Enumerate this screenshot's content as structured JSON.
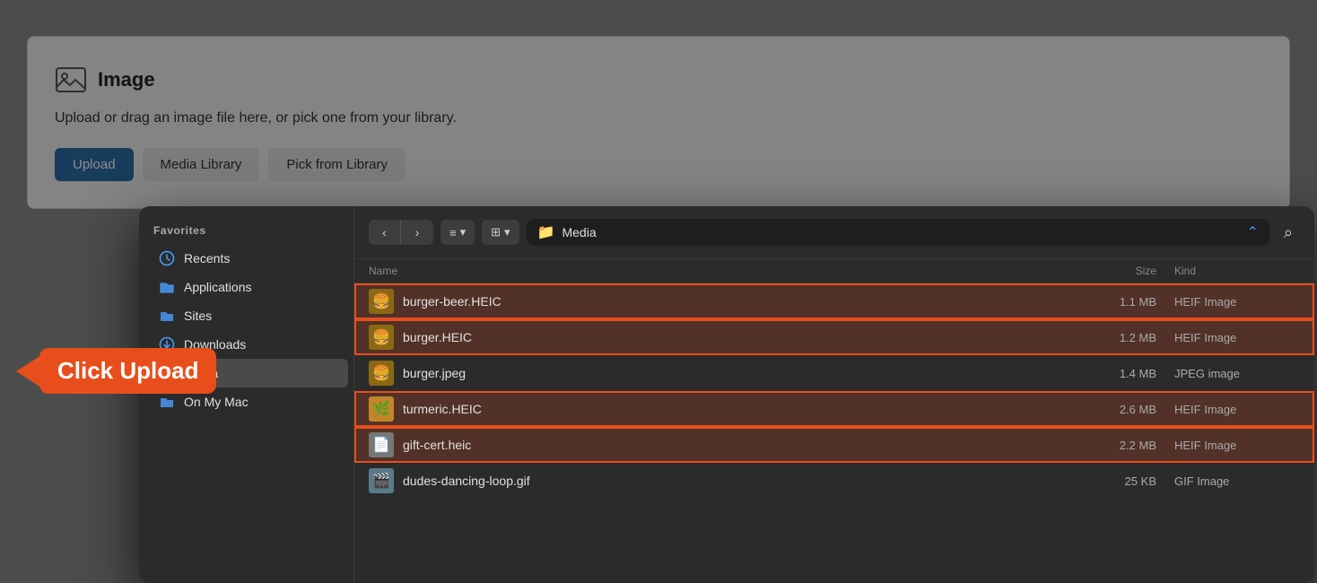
{
  "cms": {
    "title": "Image",
    "description": "Upload or drag an image file here, or pick one from your library.",
    "upload_label": "Upload",
    "media_label": "Media Library",
    "pick_label": "Pick from Library"
  },
  "toolbar": {
    "back_label": "‹",
    "forward_label": "›",
    "list_view_icon": "≡",
    "grid_view_icon": "⊞",
    "dropdown_chevron": "▾",
    "location": "Media",
    "search_icon": "🔍"
  },
  "sidebar": {
    "favorites_title": "Favorites",
    "items": [
      {
        "id": "recents",
        "label": "Recents",
        "icon": "clock"
      },
      {
        "id": "applications",
        "label": "Applications",
        "icon": "folder-blue"
      },
      {
        "id": "sites",
        "label": "Sites",
        "icon": "folder-blue"
      },
      {
        "id": "downloads",
        "label": "Downloads",
        "icon": "arrow-circle"
      },
      {
        "id": "media",
        "label": "Media",
        "icon": "folder-blue",
        "active": true
      },
      {
        "id": "on-my-mac",
        "label": "On My Mac",
        "icon": "folder-blue"
      }
    ]
  },
  "file_list": {
    "columns": [
      "Name",
      "Size",
      "Kind"
    ],
    "files": [
      {
        "name": "burger-beer.HEIC",
        "size": "1.1 MB",
        "kind": "HEIF Image",
        "thumb": "burger",
        "selected": "group1"
      },
      {
        "name": "burger.HEIC",
        "size": "1.2 MB",
        "kind": "HEIF Image",
        "thumb": "burger",
        "selected": "group1"
      },
      {
        "name": "burger.jpeg",
        "size": "1.4 MB",
        "kind": "JPEG image",
        "thumb": "burger",
        "selected": null
      },
      {
        "name": "turmeric.HEIC",
        "size": "2.6 MB",
        "kind": "HEIF Image",
        "thumb": "turmeric",
        "selected": "group2"
      },
      {
        "name": "gift-cert.heic",
        "size": "2.2 MB",
        "kind": "HEIF Image",
        "thumb": "cert",
        "selected": "group2"
      },
      {
        "name": "dudes-dancing-loop.gif",
        "size": "25 KB",
        "kind": "GIF Image",
        "thumb": "gif",
        "selected": null
      }
    ]
  },
  "annotations": {
    "click_upload": "Click Upload",
    "downloads": "Downloads"
  }
}
